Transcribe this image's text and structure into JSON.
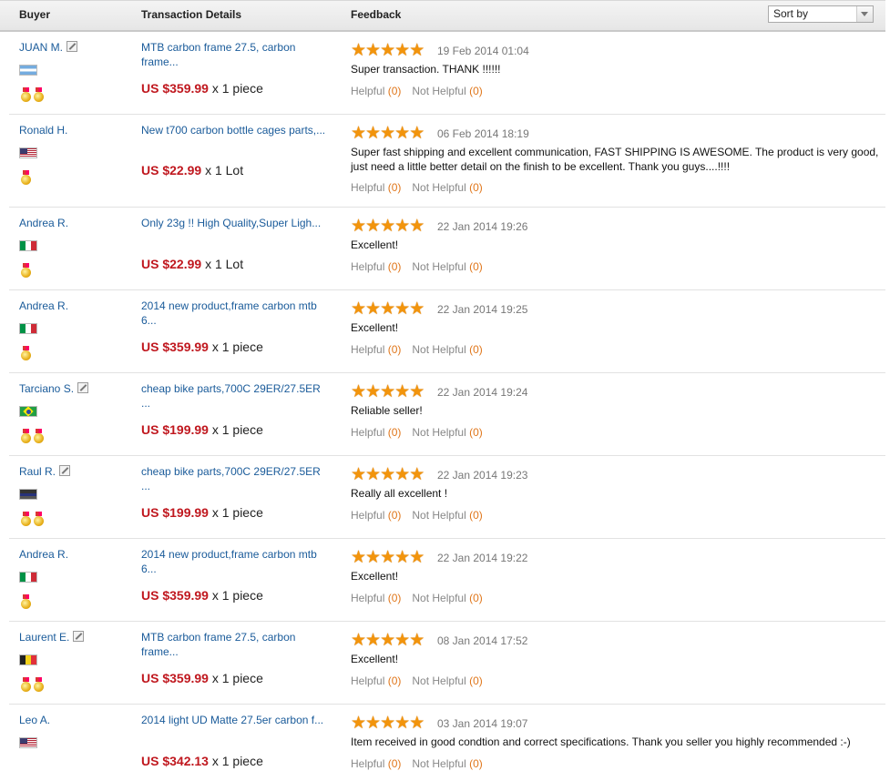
{
  "header": {
    "buyer_label": "Buyer",
    "transaction_label": "Transaction Details",
    "feedback_label": "Feedback",
    "sort_label": "Sort by"
  },
  "helpful_label": "Helpful",
  "not_helpful_label": "Not Helpful",
  "rows": [
    {
      "buyer": "JUAN M.",
      "has_edit_icon": true,
      "country": "ar",
      "medals": 2,
      "title": "MTB carbon frame 27.5, carbon frame...",
      "price": "US $359.99",
      "qty": "x 1 piece",
      "stars": 5,
      "date": "19 Feb 2014 01:04",
      "feedback": "Super transaction. THANK !!!!!!",
      "helpful_count": "(0)",
      "not_helpful_count": "(0)"
    },
    {
      "buyer": "Ronald H.",
      "has_edit_icon": false,
      "country": "us",
      "medals": 1,
      "title": "New t700 carbon bottle cages parts,...",
      "price": "US $22.99",
      "qty": "x 1 Lot",
      "stars": 5,
      "date": "06 Feb 2014 18:19",
      "feedback": "Super fast shipping and excellent communication, FAST SHIPPING IS AWESOME. The product is very good, just need a little better detail on the finish to be excellent. Thank you guys....!!!!",
      "helpful_count": "(0)",
      "not_helpful_count": "(0)"
    },
    {
      "buyer": "Andrea R.",
      "has_edit_icon": false,
      "country": "it",
      "medals": 1,
      "title": "Only 23g !! High Quality,Super Ligh...",
      "price": "US $22.99",
      "qty": "x 1 Lot",
      "stars": 5,
      "date": "22 Jan 2014 19:26",
      "feedback": "Excellent!",
      "helpful_count": "(0)",
      "not_helpful_count": "(0)"
    },
    {
      "buyer": "Andrea R.",
      "has_edit_icon": false,
      "country": "it",
      "medals": 1,
      "title": "2014 new product,frame carbon mtb 6...",
      "price": "US $359.99",
      "qty": "x 1 piece",
      "stars": 5,
      "date": "22 Jan 2014 19:25",
      "feedback": "Excellent!",
      "helpful_count": "(0)",
      "not_helpful_count": "(0)"
    },
    {
      "buyer": "Tarciano S.",
      "has_edit_icon": true,
      "country": "br",
      "medals": 2,
      "title": "cheap bike parts,700C 29ER/27.5ER ...",
      "price": "US $199.99",
      "qty": "x 1 piece",
      "stars": 5,
      "date": "22 Jan 2014 19:24",
      "feedback": "Reliable seller!",
      "helpful_count": "(0)",
      "not_helpful_count": "(0)"
    },
    {
      "buyer": "Raul R.",
      "has_edit_icon": true,
      "country": "ve",
      "medals": 2,
      "title": "cheap bike parts,700C 29ER/27.5ER ...",
      "price": "US $199.99",
      "qty": "x 1 piece",
      "stars": 5,
      "date": "22 Jan 2014 19:23",
      "feedback": "Really all excellent !",
      "helpful_count": "(0)",
      "not_helpful_count": "(0)"
    },
    {
      "buyer": "Andrea R.",
      "has_edit_icon": false,
      "country": "it",
      "medals": 1,
      "title": "2014 new product,frame carbon mtb 6...",
      "price": "US $359.99",
      "qty": "x 1 piece",
      "stars": 5,
      "date": "22 Jan 2014 19:22",
      "feedback": "Excellent!",
      "helpful_count": "(0)",
      "not_helpful_count": "(0)"
    },
    {
      "buyer": "Laurent E.",
      "has_edit_icon": true,
      "country": "be",
      "medals": 2,
      "title": "MTB carbon frame 27.5, carbon frame...",
      "price": "US $359.99",
      "qty": "x 1 piece",
      "stars": 5,
      "date": "08 Jan 2014 17:52",
      "feedback": "Excellent!",
      "helpful_count": "(0)",
      "not_helpful_count": "(0)"
    },
    {
      "buyer": "Leo A.",
      "has_edit_icon": false,
      "country": "us",
      "medals": 0,
      "title": "2014 light UD Matte 27.5er carbon f...",
      "price": "US $342.13",
      "qty": "x 1 piece",
      "stars": 5,
      "date": "03 Jan 2014 19:07",
      "feedback": "Item received in good condtion and correct specifications. Thank you seller you highly recommended :-)",
      "helpful_count": "(0)",
      "not_helpful_count": "(0)"
    }
  ]
}
